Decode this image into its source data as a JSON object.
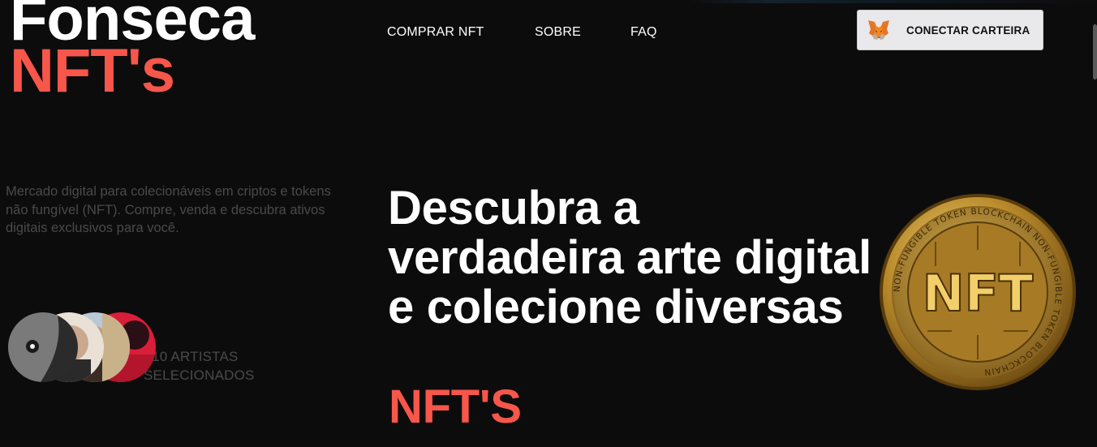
{
  "brand": {
    "line1": "Fonseca",
    "line2": "NFT's"
  },
  "nav": {
    "items": [
      "COMPRAR NFT",
      "SOBRE",
      "FAQ"
    ]
  },
  "wallet_button": {
    "label": "CONECTAR CARTEIRA",
    "icon": "metamask-fox-icon"
  },
  "intro": {
    "description": "Mercado digital para colecionáveis em criptos e tokens não fungível (NFT). Compre, venda e descubra ativos digitais exclusivos para você."
  },
  "artists": {
    "line1": "+10 ARTISTAS",
    "line2": "SELECIONADOS"
  },
  "hero": {
    "headline": "Descubra a verdadeira arte digital e colecione diversas",
    "accent": "NFT'S"
  },
  "coin": {
    "ring_text": "NON-FUNGIBLE TOKEN BLOCKCHAIN NON-FUNGIBLE TOKEN BLOCKCHAIN",
    "center_text": "NFT"
  },
  "colors": {
    "accent": "#f7564a",
    "background": "#0d0c0d",
    "muted_text": "#4a4a4a",
    "button_bg": "#e9e8ea",
    "gold": "#c9a237"
  }
}
